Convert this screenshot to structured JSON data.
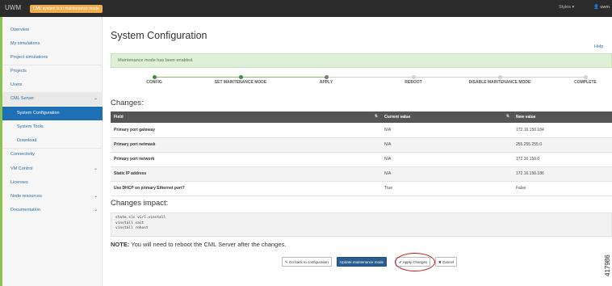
{
  "topbar": {
    "brand": "UWM",
    "maintenance_badge": "CML system is in maintenance mode",
    "styles_label": "Styles ▾",
    "user_label": "👤 uwm"
  },
  "sidebar": {
    "items": [
      {
        "label": "Overview"
      },
      {
        "label": "My simulations"
      },
      {
        "label": "Project simulations"
      },
      {
        "label": "Projects"
      },
      {
        "label": "Users"
      },
      {
        "label": "CML Server",
        "chevron": "⌄"
      },
      {
        "label": "System Configuration"
      },
      {
        "label": "System Tools"
      },
      {
        "label": "Download"
      },
      {
        "label": "Connectivity"
      },
      {
        "label": "VM Control",
        "chevron": "⌄"
      },
      {
        "label": "Licenses"
      },
      {
        "label": "Node resources",
        "chevron": "⌄"
      },
      {
        "label": "Documentation",
        "chevron": "⌄"
      }
    ]
  },
  "main": {
    "title": "System Configuration",
    "help_link": "Help",
    "alert": "Maintenance mode has been enabled.",
    "steps": [
      {
        "label": "CONFIG",
        "state": "done"
      },
      {
        "label": "SET MAINTENANCE MODE",
        "state": "done"
      },
      {
        "label": "APPLY",
        "state": "current"
      },
      {
        "label": "REBOOT",
        "state": "pending"
      },
      {
        "label": "DISABLE MAINTENANCE MODE",
        "state": "pending"
      },
      {
        "label": "COMPLETE",
        "state": "pending"
      }
    ],
    "changes_title": "Changes:",
    "table": {
      "headers": [
        "Field",
        "Current value",
        "New value"
      ],
      "rows": [
        {
          "field": "Primary port gateway",
          "current": "N/A",
          "new": "172.16.150.184"
        },
        {
          "field": "Primary port netmask",
          "current": "N/A",
          "new": "255.255.255.0"
        },
        {
          "field": "Primary port network",
          "current": "N/A",
          "new": "172.16.150.0"
        },
        {
          "field": "Static IP address",
          "current": "N/A",
          "new": "172.16.150.186"
        },
        {
          "field": "Use DHCP on primary Ethernet port?",
          "current": "True",
          "new": "False"
        }
      ]
    },
    "impact_title": "Changes impact:",
    "impact_lines": [
      "state.sls virl.vinstall",
      "vinstall salt",
      "vinstall rehost"
    ],
    "note_label": "NOTE:",
    "note_text": " You will need to reboot the CML Server after the changes.",
    "buttons": {
      "back": "✎ Go back to configuration",
      "update": "Update maintenance mode",
      "apply": "✔ Apply Changes",
      "cancel": "✖ Cancel"
    },
    "figure_id": "417986"
  },
  "colors": {
    "sidebar_active": "#1f6fb5",
    "alert_bg": "#dff0d8",
    "step_done": "#3c8d3c",
    "table_header": "#555555",
    "highlight_oval": "#b91d1d"
  }
}
